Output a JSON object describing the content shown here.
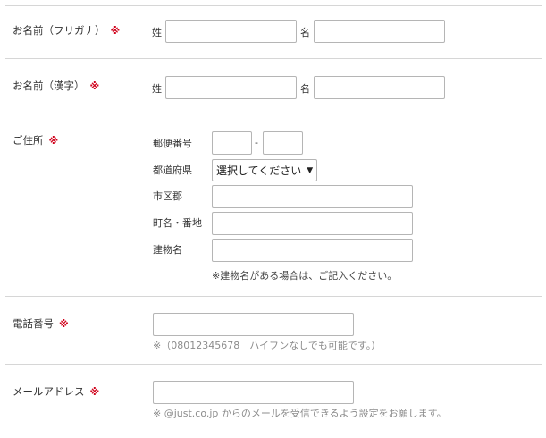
{
  "required_mark": "※",
  "name_kana": {
    "label": "お名前（フリガナ）",
    "last_label": "姓",
    "first_label": "名",
    "last_value": "",
    "first_value": ""
  },
  "name_kanji": {
    "label": "お名前（漢字）",
    "last_label": "姓",
    "first_label": "名",
    "last_value": "",
    "first_value": ""
  },
  "address": {
    "label": "ご住所",
    "postal_label": "郵便番号",
    "postal_separator": "-",
    "postal_first_value": "",
    "postal_second_value": "",
    "prefecture_label": "都道府県",
    "prefecture_selected": "選択してください",
    "city_label": "市区郡",
    "city_value": "",
    "street_label": "町名・番地",
    "street_value": "",
    "building_label": "建物名",
    "building_value": "",
    "building_note": "※建物名がある場合は、ご記入ください。"
  },
  "phone": {
    "label": "電話番号",
    "value": "",
    "note": "※（08012345678　ハイフンなしでも可能です。）"
  },
  "email": {
    "label": "メールアドレス",
    "value": "",
    "note": "※ @just.co.jp からのメールを受信できるよう設定をお願します。"
  },
  "colors": {
    "required": "#d0021b",
    "border": "#d6d6d6",
    "note": "#8c8c8c"
  }
}
